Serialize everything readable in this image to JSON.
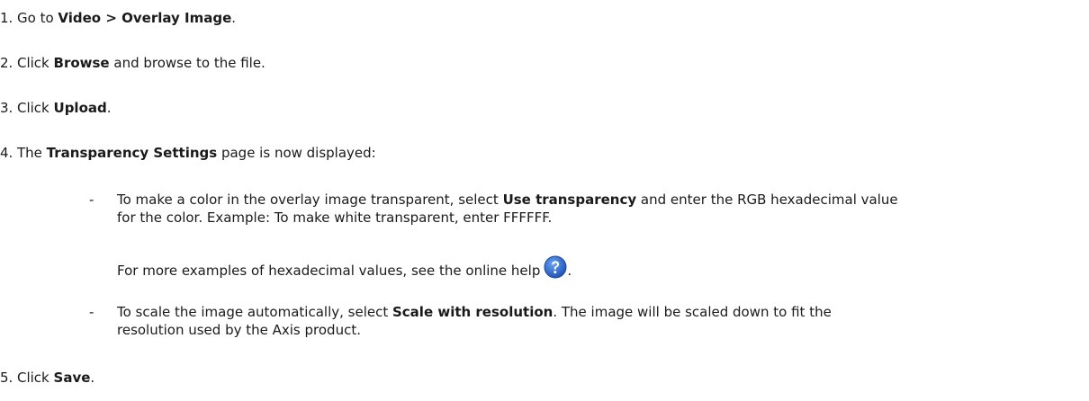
{
  "steps": [
    {
      "num": "1.",
      "pre": "Go to ",
      "bold": "Video > Overlay Image",
      "post": "."
    },
    {
      "num": "2.",
      "pre": "Click ",
      "bold": "Browse",
      "post": " and browse to the file."
    },
    {
      "num": "3.",
      "pre": "Click ",
      "bold": "Upload",
      "post": "."
    },
    {
      "num": "4.",
      "pre": "The ",
      "bold": "Transparency Settings",
      "post": " page is now displayed:"
    },
    {
      "num": "5.",
      "pre": "Click ",
      "bold": "Save",
      "post": "."
    }
  ],
  "bullets": {
    "dash": "-",
    "transparency": {
      "pre": "To make a color in the overlay image transparent, select ",
      "bold": "Use transparency",
      "post": " and enter the RGB hexadecimal value",
      "line2": "for the color. Example: To make white transparent, enter FFFFFF.",
      "help_pre": "For more examples of hexadecimal values, see the online help",
      "help_post": ".",
      "help_icon": "help-question-icon"
    },
    "scale": {
      "pre": "To scale the image automatically, select ",
      "bold": "Scale with resolution",
      "post": ". The image will be scaled down to fit the",
      "line2": "resolution used by the Axis product."
    }
  },
  "colors": {
    "text": "#1a1a1a",
    "help_icon": "#2a63c9"
  }
}
